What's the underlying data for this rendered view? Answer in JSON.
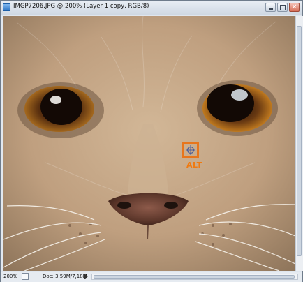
{
  "window": {
    "title": "IMGP7206.JPG @ 200% (Layer 1 copy, RGB/8)",
    "buttons": {
      "minimize": "minimize",
      "maximize": "maximize",
      "close": "close"
    }
  },
  "canvas": {
    "annotation_label": "ALT",
    "colors": {
      "fur": "#c8ac8c",
      "eye": "#7a4f1f",
      "pupil": "#120a07",
      "marker": "#e8761c"
    }
  },
  "status": {
    "zoom": "200%",
    "doc": "Doc: 3,59M/7,18M"
  }
}
